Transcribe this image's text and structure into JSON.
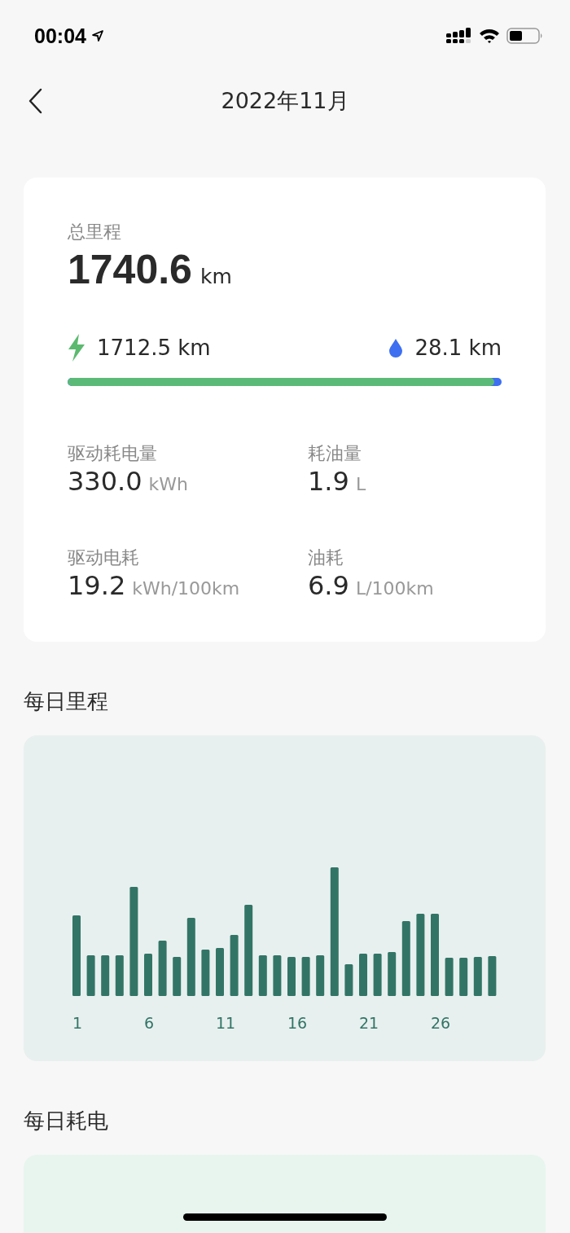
{
  "status_bar": {
    "time": "00:04"
  },
  "nav": {
    "title": "2022年11月"
  },
  "summary": {
    "label": "总里程",
    "value": "1740.6",
    "unit": "km",
    "electric": {
      "distance": "1712.5 km"
    },
    "fuel": {
      "distance": "28.1 km"
    },
    "split": {
      "level": 0.984
    },
    "stats": [
      {
        "label": "驱动耗电量",
        "value": "330.0",
        "unit": "kWh"
      },
      {
        "label": "耗油量",
        "value": "1.9",
        "unit": "L"
      },
      {
        "label": "驱动电耗",
        "value": "19.2",
        "unit": "kWh/100km"
      },
      {
        "label": "油耗",
        "value": "6.9",
        "unit": "L/100km"
      }
    ]
  },
  "daily_mileage": {
    "title": "每日里程",
    "x_labels": [
      "1",
      "6",
      "11",
      "16",
      "21",
      "26"
    ]
  },
  "daily_energy": {
    "title": "每日耗电"
  }
}
